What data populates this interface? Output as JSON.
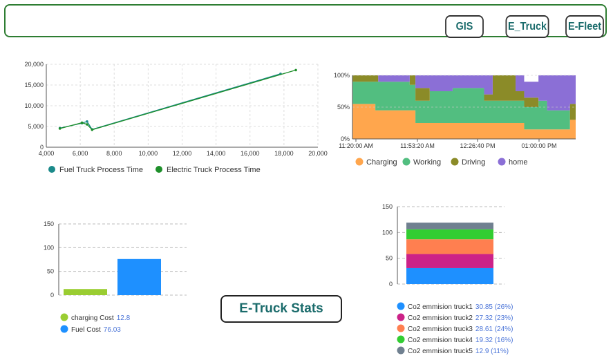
{
  "nav": {
    "gis": "GIS",
    "etruck": "E_Truck",
    "efleet": "E-Fleet"
  },
  "stats_title": "E-Truck Stats",
  "colors": {
    "fuel": "#1b8a8a",
    "electric": "#1e8f2a",
    "charging": "#ffa64d",
    "working": "#52be80",
    "driving": "#8b8b28",
    "home": "#8b6fd6",
    "charging_cost": "#9acd32",
    "fuel_cost": "#1e90ff",
    "truck1": "#1e90ff",
    "truck2": "#cc2288",
    "truck3": "#ff7f50",
    "truck4": "#32cd32",
    "truck5": "#708090"
  },
  "chart_data": [
    {
      "type": "line",
      "xlim": [
        4000,
        20000
      ],
      "ylim": [
        0,
        20000
      ],
      "x_ticks": [
        "4,000",
        "6,000",
        "8,000",
        "10,000",
        "12,000",
        "14,000",
        "16,000",
        "18,000",
        "20,000"
      ],
      "y_ticks": [
        "0",
        "5,000",
        "10,000",
        "15,000",
        "20,000"
      ],
      "grid": true,
      "legend_position": "bottom",
      "series": [
        {
          "name": "Fuel Truck Process Time",
          "points": [
            [
              4800,
              4600
            ],
            [
              6100,
              5800
            ],
            [
              6400,
              6200
            ],
            [
              6700,
              4300
            ],
            [
              17800,
              17700
            ]
          ]
        },
        {
          "name": "Electric Truck Process Time",
          "points": [
            [
              4800,
              4500
            ],
            [
              6100,
              5900
            ],
            [
              6400,
              5500
            ],
            [
              6700,
              4200
            ],
            [
              18700,
              18600
            ]
          ]
        }
      ]
    },
    {
      "type": "area",
      "stacked_percent": true,
      "x_ticks": [
        "11:20:00 AM",
        "11:53:20 AM",
        "12:26:40 PM",
        "01:00:00 PM"
      ],
      "y_ticks": [
        "0%",
        "50%",
        "100%"
      ],
      "x_minutes": [
        0,
        8,
        9,
        18,
        20,
        22,
        27,
        35,
        39,
        46,
        49,
        57,
        60,
        65,
        68,
        73,
        76,
        78
      ],
      "series": [
        {
          "name": "Charging",
          "values": [
            55,
            45,
            45,
            45,
            45,
            25,
            25,
            25,
            25,
            25,
            25,
            25,
            15,
            15,
            15,
            15,
            30,
            30
          ]
        },
        {
          "name": "Working",
          "values": [
            35,
            45,
            45,
            45,
            40,
            35,
            50,
            55,
            55,
            35,
            35,
            35,
            35,
            45,
            30,
            30,
            0,
            0
          ]
        },
        {
          "name": "Driving",
          "values": [
            10,
            10,
            0,
            0,
            15,
            20,
            0,
            0,
            0,
            10,
            40,
            15,
            15,
            0,
            0,
            0,
            25,
            25
          ]
        },
        {
          "name": "home",
          "values": [
            0,
            0,
            10,
            10,
            0,
            20,
            25,
            20,
            20,
            30,
            0,
            25,
            25,
            40,
            55,
            55,
            45,
            45
          ]
        }
      ],
      "legend_position": "bottom"
    },
    {
      "type": "bar",
      "ylim": [
        0,
        150
      ],
      "y_ticks": [
        "0",
        "50",
        "100",
        "150"
      ],
      "categories": [
        "charging Cost",
        "Fuel Cost"
      ],
      "values": [
        12.8,
        76.03
      ],
      "legend": [
        {
          "label": "charging Cost",
          "value": "12.8"
        },
        {
          "label": "Fuel Cost",
          "value": "76.03"
        }
      ]
    },
    {
      "type": "bar",
      "stacked": true,
      "ylim": [
        0,
        150
      ],
      "y_ticks": [
        "0",
        "50",
        "100",
        "150"
      ],
      "series": [
        {
          "name": "Co2 emmision truck1",
          "value": 30.85,
          "label": "30.85 (26%)"
        },
        {
          "name": "Co2 emmision truck2",
          "value": 27.32,
          "label": "27.32 (23%)"
        },
        {
          "name": "Co2 emmision truck3",
          "value": 28.61,
          "label": "28.61 (24%)"
        },
        {
          "name": "Co2 emmision truck4",
          "value": 19.32,
          "label": "19.32 (16%)"
        },
        {
          "name": "Co2 emmision truck5",
          "value": 12.9,
          "label": "12.9 (11%)"
        }
      ]
    }
  ]
}
